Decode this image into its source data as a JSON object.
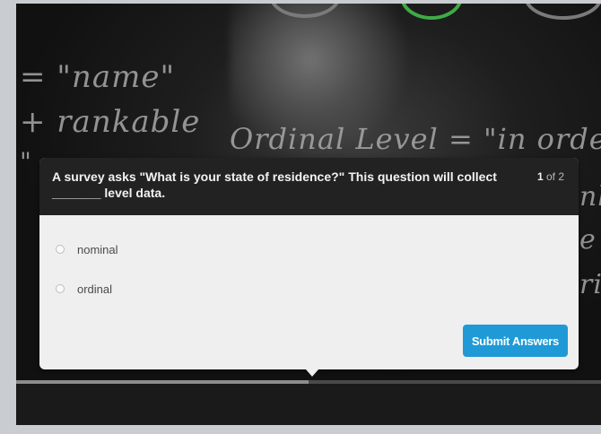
{
  "background": {
    "chalk_lines": [
      "= \"name\"",
      "+ rankable",
      "\"",
      "Ordinal Level = \"in order\"",
      "nk",
      "e",
      "ril"
    ]
  },
  "quiz": {
    "question": "A survey asks \"What is your state of residence?\" This question will collect _______ level data.",
    "counter_current": "1",
    "counter_of": "of 2",
    "options": [
      {
        "label": "nominal",
        "selected": false
      },
      {
        "label": "ordinal",
        "selected": false
      }
    ],
    "submit_label": "Submit Answers"
  },
  "player": {
    "progress": 0.5
  },
  "colors": {
    "submit": "#1f9ad6",
    "header": "#222222",
    "card": "#efefef",
    "dial_active": "#3faa47"
  }
}
